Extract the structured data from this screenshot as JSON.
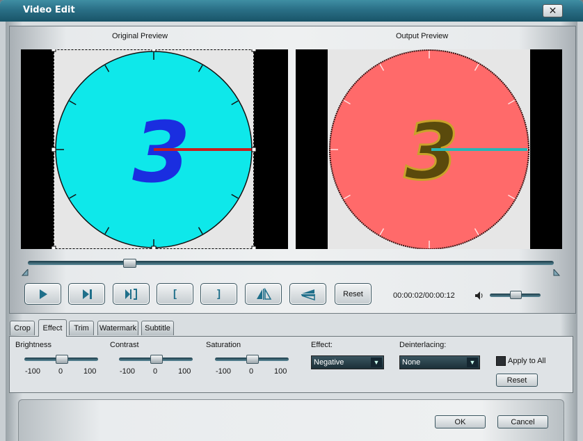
{
  "window": {
    "title": "Video Edit",
    "close_glyph": "✕"
  },
  "preview": {
    "original_title": "Original Preview",
    "output_title": "Output Preview",
    "clock_digit": "3",
    "colors": {
      "original_face": "#0ee8ea",
      "original_digit": "#1a2ee0",
      "original_hand": "#c81e1e",
      "output_face": "#ff6a6a",
      "output_digit": "#5a4a0c",
      "output_hand": "#27b6b6"
    }
  },
  "timeline": {
    "progress_fraction": 0.145
  },
  "controls": {
    "buttons": [
      {
        "name": "play-button",
        "icon": "play-icon"
      },
      {
        "name": "next-frame-button",
        "icon": "step-forward-icon"
      },
      {
        "name": "snapshot-button",
        "icon": "frame-bracket-icon"
      },
      {
        "name": "set-start-button",
        "icon": "start-bracket-icon"
      },
      {
        "name": "set-end-button",
        "icon": "end-bracket-icon"
      },
      {
        "name": "flip-horizontal-button",
        "icon": "flip-horizontal-icon"
      },
      {
        "name": "flip-vertical-button",
        "icon": "flip-vertical-icon"
      }
    ],
    "start_bracket": "[",
    "end_bracket": "]",
    "reset_label": "Reset",
    "time": "00:00:02/00:00:12",
    "volume_fraction": 0.5
  },
  "tabs": [
    {
      "label": "Crop",
      "active": false
    },
    {
      "label": "Effect",
      "active": true
    },
    {
      "label": "Trim",
      "active": false
    },
    {
      "label": "Watermark",
      "active": false
    },
    {
      "label": "Subtitle",
      "active": false
    }
  ],
  "effect": {
    "brightness": {
      "label": "Brightness",
      "min": "-100",
      "mid": "0",
      "max": "100",
      "value": 0
    },
    "contrast": {
      "label": "Contrast",
      "min": "-100",
      "mid": "0",
      "max": "100",
      "value": 0
    },
    "saturation": {
      "label": "Saturation",
      "min": "-100",
      "mid": "0",
      "max": "100",
      "value": 0
    },
    "effect_label": "Effect:",
    "effect_value": "Negative",
    "deinterlacing_label": "Deinterlacing:",
    "deinterlacing_value": "None",
    "apply_all_label": "Apply to All",
    "apply_all_checked": false,
    "reset_label": "Reset"
  },
  "footer": {
    "ok_label": "OK",
    "cancel_label": "Cancel"
  }
}
